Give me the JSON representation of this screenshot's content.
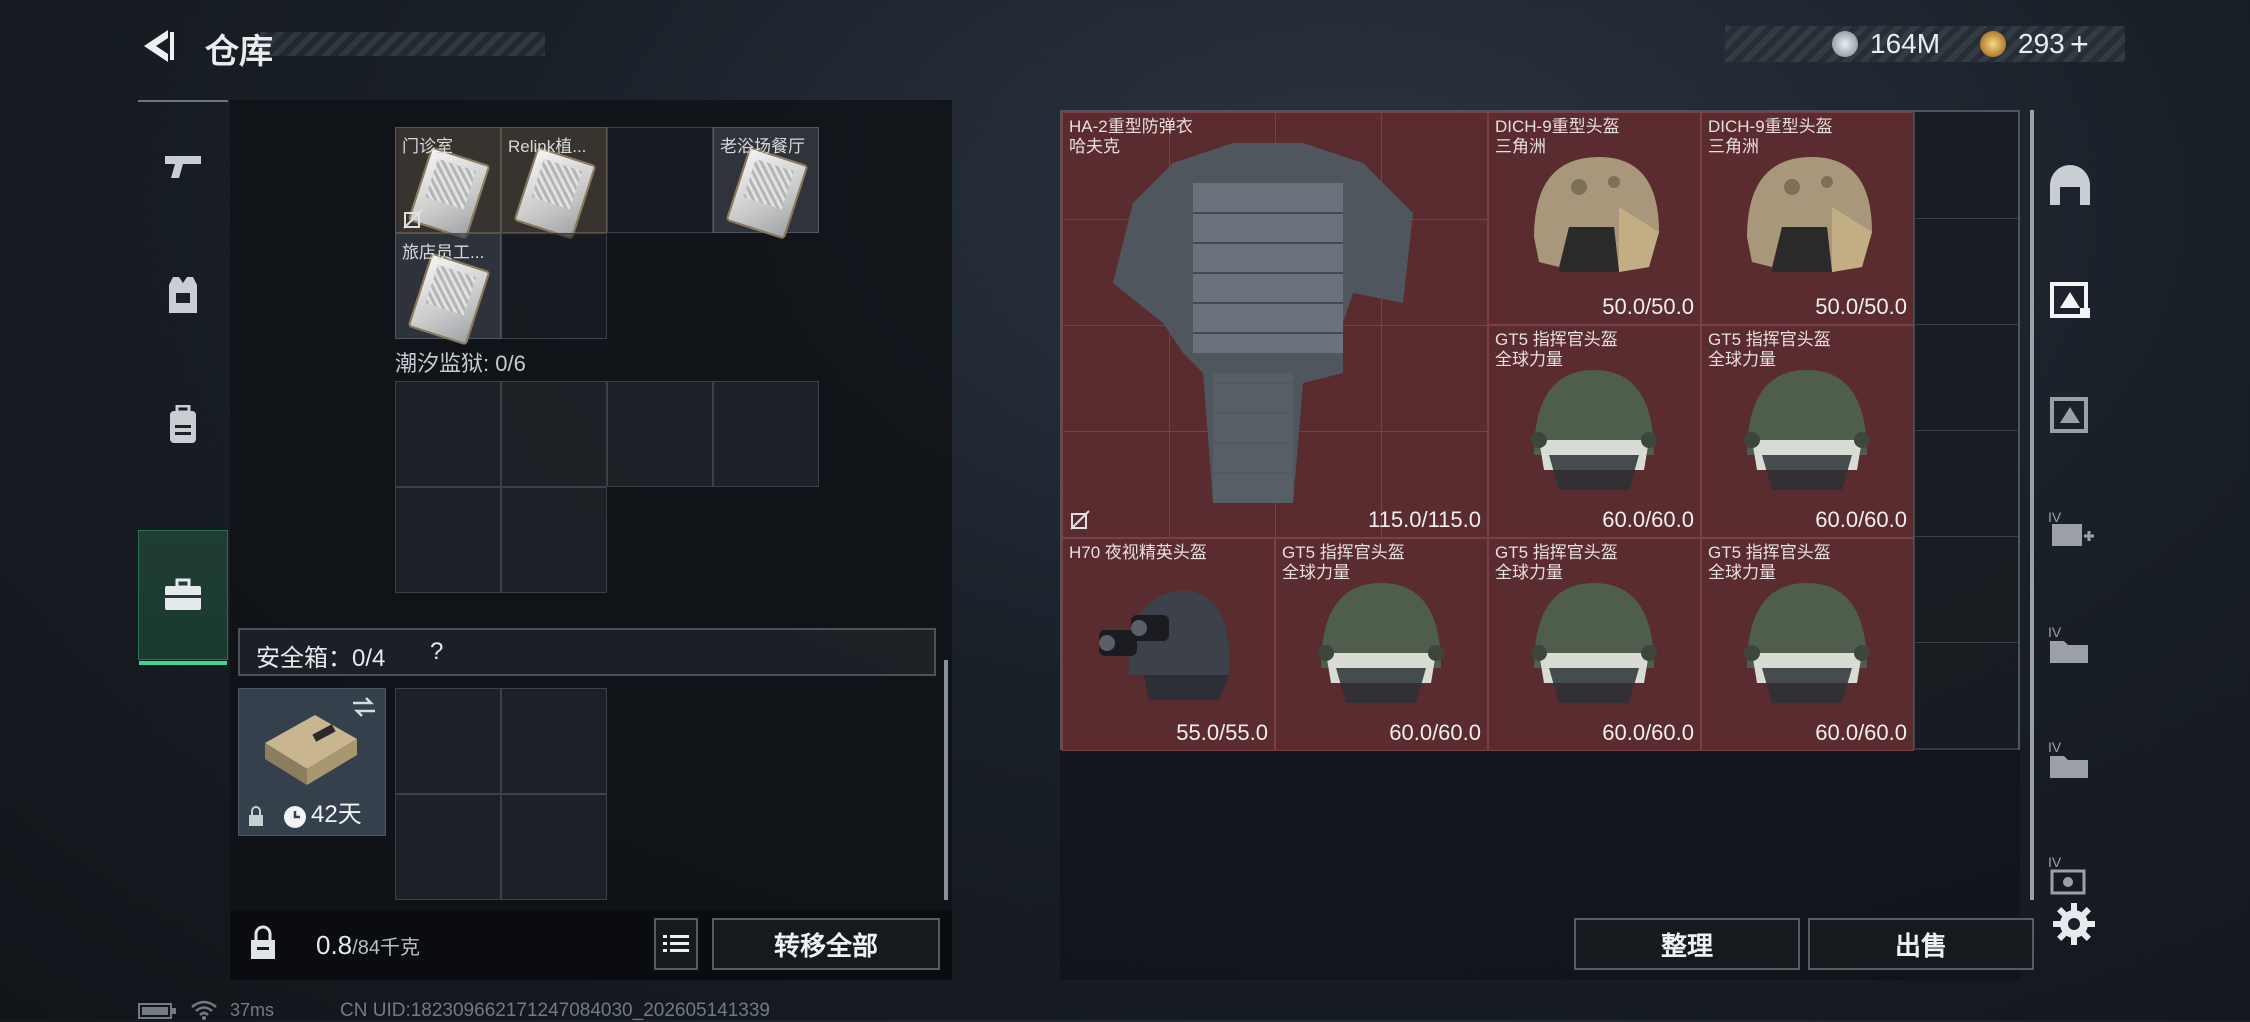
{
  "header": {
    "title": "仓库",
    "currency1_value": "164M",
    "currency2_value": "293",
    "currency2_add": "+"
  },
  "left_nav": {
    "items": [
      {
        "icon": "pistol-icon"
      },
      {
        "icon": "armor-vest-icon"
      },
      {
        "icon": "backpack-icon"
      },
      {
        "icon": "toolbox-icon",
        "active": true
      }
    ]
  },
  "keys_section": {
    "cells": [
      {
        "label": "门诊室"
      },
      {
        "label": "Relink植..."
      },
      {
        "label": ""
      },
      {
        "label": "老浴场餐厅"
      },
      {
        "label": "旅店员工..."
      }
    ]
  },
  "prison_section": {
    "label": "潮汐监狱: 0/6"
  },
  "safebox": {
    "label": "安全箱：0/4",
    "help": "?",
    "days": "42天"
  },
  "bottom": {
    "weight_current": "0.8",
    "weight_max": "/84千克",
    "transfer_all": "转移全部"
  },
  "stash": {
    "items": [
      {
        "name": "HA-2重型防弹衣",
        "sub": "哈夫克",
        "durability": "115.0/115.0"
      },
      {
        "name": "DICH-9重型头盔",
        "sub": "三角洲",
        "durability": "50.0/50.0"
      },
      {
        "name": "DICH-9重型头盔",
        "sub": "三角洲",
        "durability": "50.0/50.0"
      },
      {
        "name": "GT5 指挥官头盔",
        "sub": "全球力量",
        "durability": "60.0/60.0"
      },
      {
        "name": "GT5 指挥官头盔",
        "sub": "全球力量",
        "durability": "60.0/60.0"
      },
      {
        "name": "H70 夜视精英头盔",
        "sub": "",
        "durability": "55.0/55.0"
      },
      {
        "name": "GT5 指挥官头盔",
        "sub": "全球力量",
        "durability": "60.0/60.0"
      },
      {
        "name": "GT5 指挥官头盔",
        "sub": "全球力量",
        "durability": "60.0/60.0"
      },
      {
        "name": "GT5 指挥官头盔",
        "sub": "全球力量",
        "durability": "60.0/60.0"
      }
    ],
    "sort_label": "整理",
    "sell_label": "出售"
  },
  "status": {
    "ping": "37ms",
    "uid": "CN UID:18230966217124708403​0_202605141339"
  }
}
